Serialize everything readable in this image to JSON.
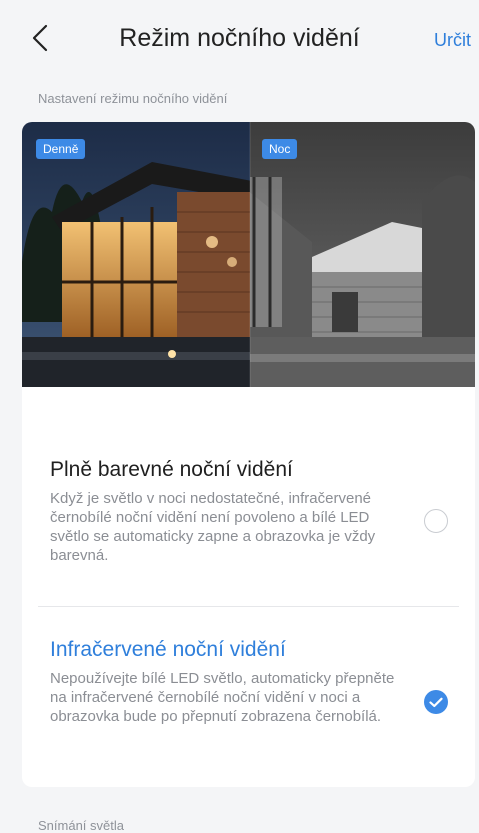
{
  "header": {
    "title": "Režim nočního vidění",
    "confirm_label": "Určit"
  },
  "section_night_mode": {
    "label": "Nastavení režimu nočního vidění"
  },
  "preview": {
    "day_tag": "Denně",
    "night_tag": "Noc"
  },
  "options": [
    {
      "title": "Plně barevné noční vidění",
      "description": "Když je světlo v noci nedostatečné, infračervené černobílé noční vidění není povoleno a bílé LED světlo se automaticky zapne a obrazovka je vždy barevná.",
      "selected": false,
      "title_color": "#1f1f1f"
    },
    {
      "title": "Infračervené noční vidění",
      "description": "Nepoužívejte bílé LED světlo, automaticky přepněte na infračervené černobílé noční vidění v noci a obrazovka bude po přepnutí zobrazena černobílá.",
      "selected": true,
      "title_color": "#2f7fdb"
    }
  ],
  "section_light_sensing": {
    "label": "Snímání světla"
  },
  "colors": {
    "accent": "#3d8ae6",
    "background": "#f4f5f7"
  }
}
